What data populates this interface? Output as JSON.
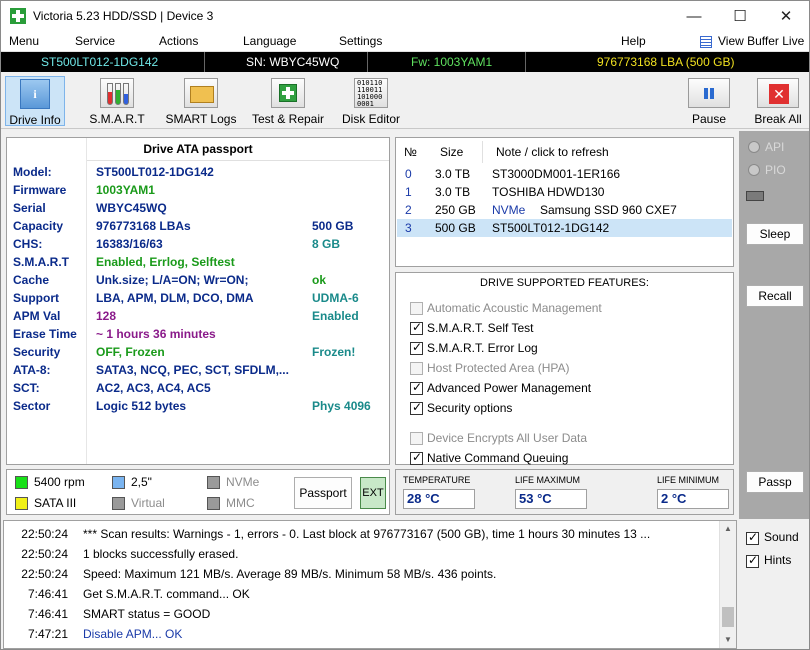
{
  "window": {
    "title": "Victoria 5.23 HDD/SSD | Device 3",
    "minimize": "—",
    "maximize": "☐",
    "close": "✕"
  },
  "menu": {
    "items": [
      "Menu",
      "Service",
      "Actions",
      "Language",
      "Settings",
      "Help"
    ],
    "view_buffer": "View Buffer Live"
  },
  "infobar": {
    "model": "ST500LT012-1DG142",
    "sn": "SN: WBYC45WQ",
    "fw": "Fw: 1003YAM1",
    "lba": "976773168 LBA (500 GB)"
  },
  "toolbar": {
    "buttons": [
      "Drive Info",
      "S.M.A.R.T",
      "SMART Logs",
      "Test & Repair",
      "Disk Editor",
      "Pause",
      "Break All"
    ],
    "pause_icon": "pause-icon",
    "break_icon": "close-icon"
  },
  "passport": {
    "title": "Drive ATA passport",
    "rows": [
      {
        "label": "Model:",
        "value": "ST500LT012-1DG142",
        "extra": ""
      },
      {
        "label": "Firmware",
        "value": "1003YAM1",
        "extra": ""
      },
      {
        "label": "Serial",
        "value": "WBYC45WQ",
        "extra": ""
      },
      {
        "label": "Capacity",
        "value": "976773168 LBAs",
        "extra": "500 GB"
      },
      {
        "label": "CHS:",
        "value": "16383/16/63",
        "extra": "8 GB"
      },
      {
        "label": "S.M.A.R.T",
        "value": "Enabled, Errlog, Selftest",
        "extra": ""
      },
      {
        "label": "Cache",
        "value": "Unk.size; L/A=ON; Wr=ON;",
        "extra": "ok"
      },
      {
        "label": "Support",
        "value": "LBA, APM, DLM, DCO, DMA",
        "extra": "UDMA-6"
      },
      {
        "label": "APM Val",
        "value": "128",
        "extra": "Enabled"
      },
      {
        "label": "Erase Time",
        "value": "~ 1 hours 36 minutes",
        "extra": ""
      },
      {
        "label": "Security",
        "value": "OFF, Frozen",
        "extra": "Frozen!"
      },
      {
        "label": "ATA-8:",
        "value": "SATA3, NCQ, PEC, SCT, SFDLM,...",
        "extra": ""
      },
      {
        "label": "SCT:",
        "value": "AC2, AC3, AC4, AC5",
        "extra": ""
      },
      {
        "label": "Sector",
        "value": "Logic 512 bytes",
        "extra": "Phys 4096"
      }
    ]
  },
  "legend": {
    "items": [
      "5400 rpm",
      "2,5\"",
      "NVMe",
      "SATA III",
      "Virtual",
      "MMC"
    ],
    "colors": [
      "#18e018",
      "#7ab4f0",
      "#9a9a9a",
      "#f0f018",
      "#9a9a9a",
      "#9a9a9a"
    ],
    "passport_btn": "Passport",
    "ext_btn": "EXT"
  },
  "devices": {
    "headers": [
      "№",
      "Size",
      "Note / click to refresh"
    ],
    "rows": [
      {
        "n": "0",
        "size": "3.0 TB",
        "iface": "",
        "note": "ST3000DM001-1ER166"
      },
      {
        "n": "1",
        "size": "3.0 TB",
        "iface": "",
        "note": "TOSHIBA HDWD130"
      },
      {
        "n": "2",
        "size": "250 GB",
        "iface": "NVMe",
        "note": "Samsung SSD 960 CXE7"
      },
      {
        "n": "3",
        "size": "500 GB",
        "iface": "",
        "note": "ST500LT012-1DG142"
      }
    ]
  },
  "features": {
    "title": "DRIVE SUPPORTED FEATURES:",
    "items": [
      {
        "label": "Automatic Acoustic Management",
        "checked": false
      },
      {
        "label": "S.M.A.R.T. Self Test",
        "checked": true
      },
      {
        "label": "S.M.A.R.T. Error Log",
        "checked": true
      },
      {
        "label": "Host Protected Area (HPA)",
        "checked": false
      },
      {
        "label": "Advanced Power Management",
        "checked": true
      },
      {
        "label": "Security options",
        "checked": true
      },
      {
        "label": "Device Encrypts All User Data",
        "checked": false
      },
      {
        "label": "Native Command Queuing",
        "checked": true
      }
    ]
  },
  "gauges": {
    "temperature_label": "TEMPERATURE",
    "temperature": "28 °C",
    "life_max_label": "LIFE MAXIMUM",
    "life_max": "53 °C",
    "life_min_label": "LIFE MINIMUM",
    "life_min": "2 °C"
  },
  "side": {
    "api": "API",
    "pio": "PIO",
    "sleep": "Sleep",
    "recall": "Recall",
    "passp": "Passp",
    "sound": "Sound",
    "hints": "Hints"
  },
  "log": [
    {
      "time": "22:50:24",
      "text": "*** Scan results: Warnings - 1, errors - 0. Last block at 976773167 (500 GB), time 1 hours 30 minutes 13 ...",
      "color": "#000"
    },
    {
      "time": "22:50:24",
      "text": "1 blocks successfully erased.",
      "color": "#000"
    },
    {
      "time": "22:50:24",
      "text": "Speed: Maximum 121 MB/s. Average 89 MB/s. Minimum 58 MB/s. 436 points.",
      "color": "#000"
    },
    {
      "time": "7:46:41",
      "text": "Get S.M.A.R.T. command... OK",
      "color": "#000"
    },
    {
      "time": "7:46:41",
      "text": "SMART status = GOOD",
      "color": "#000"
    },
    {
      "time": "7:47:21",
      "text": "Disable APM... OK",
      "color": "#1a3aa8"
    }
  ]
}
